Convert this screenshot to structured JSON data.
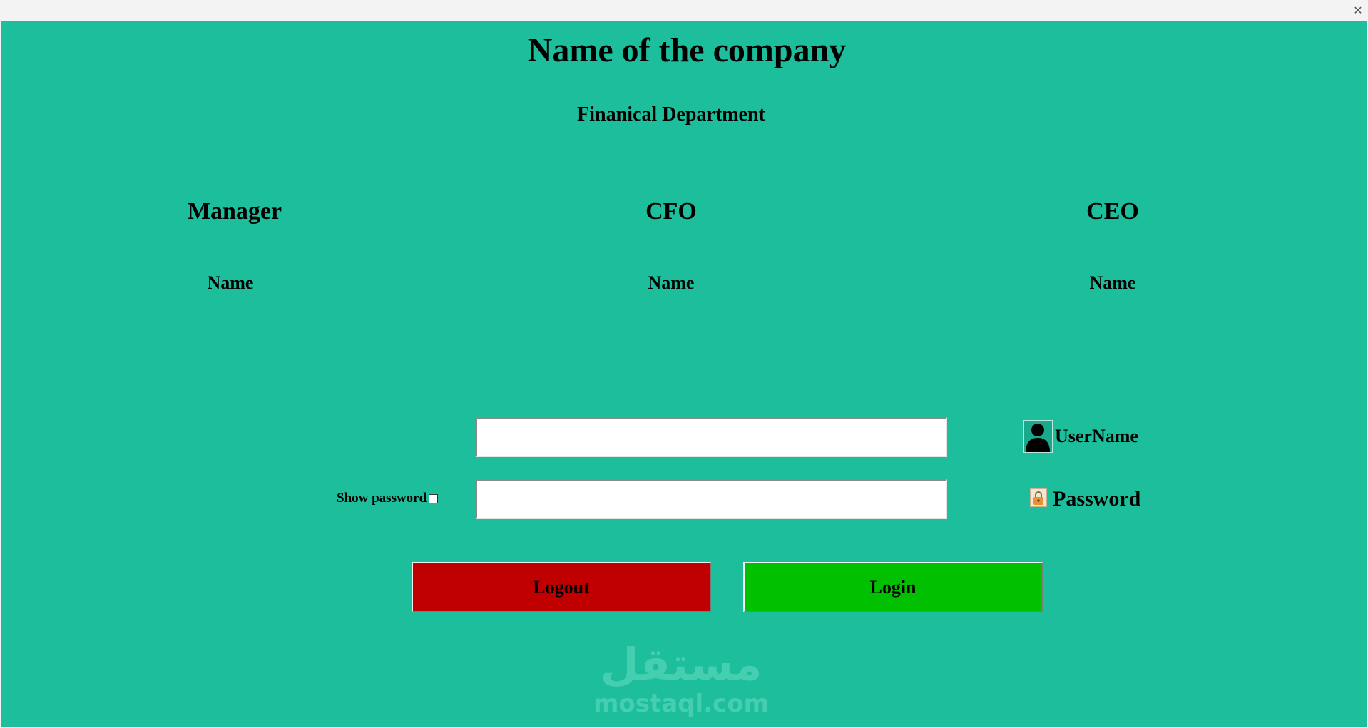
{
  "window": {
    "close_glyph": "✕"
  },
  "header": {
    "company": "Name of the company",
    "department": "Finanical Department"
  },
  "roles": [
    {
      "title": "Manager",
      "name": "Name"
    },
    {
      "title": "CFO",
      "name": "Name"
    },
    {
      "title": "CEO",
      "name": "Name"
    }
  ],
  "login": {
    "username_label": "UserName",
    "username_value": "",
    "password_label": "Password",
    "password_value": "",
    "show_password_label": "Show password",
    "show_password_checked": false,
    "logout_label": "Logout",
    "login_label": "Login"
  },
  "icons": {
    "user": "user-icon",
    "lock": "lock-icon"
  },
  "colors": {
    "background": "#1cbe9c",
    "logout": "#c00000",
    "login": "#00c000"
  },
  "watermark": {
    "arabic": "مستقل",
    "latin": "mostaql.com"
  }
}
